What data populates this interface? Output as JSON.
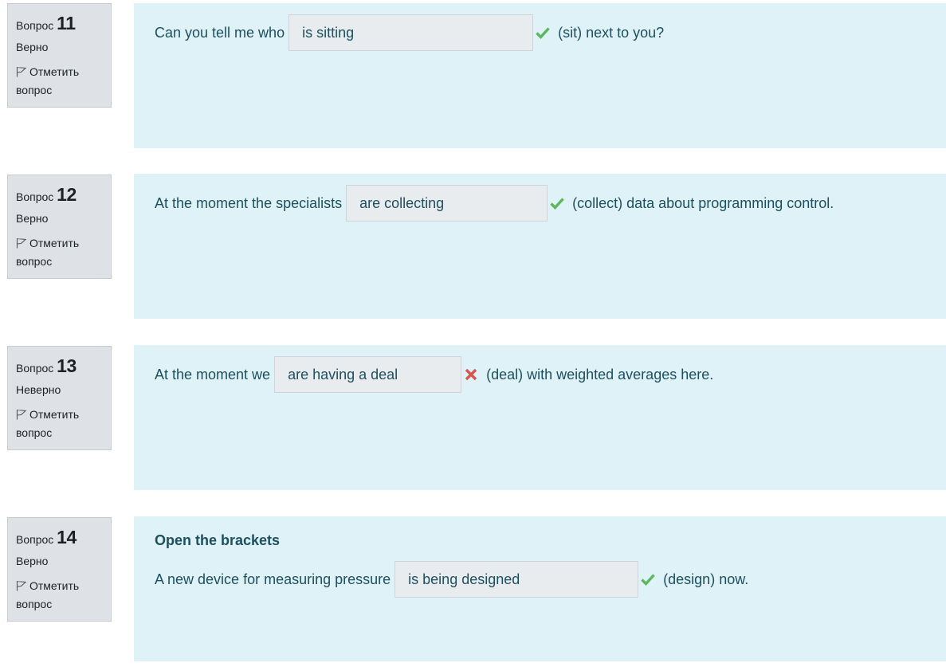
{
  "questions": [
    {
      "label": "Вопрос",
      "number": "11",
      "state": "Верно",
      "flag_label": "Отметить вопрос",
      "heading": "",
      "text_before": "Can you tell me who",
      "answer": "is sitting",
      "mark": "check-icon",
      "text_after": "(sit) next to you?"
    },
    {
      "label": "Вопрос",
      "number": "12",
      "state": "Верно",
      "flag_label": "Отметить вопрос",
      "heading": "",
      "text_before": "At the moment the specialists",
      "answer": "are collecting",
      "mark": "check-icon",
      "text_after": "(collect) data about programming control."
    },
    {
      "label": "Вопрос",
      "number": "13",
      "state": "Неверно",
      "flag_label": "Отметить вопрос",
      "heading": "",
      "text_before": "At the moment we",
      "answer": "are having a deal",
      "mark": "cross-icon",
      "text_after": "(deal) with weighted averages here."
    },
    {
      "label": "Вопрос",
      "number": "14",
      "state": "Верно",
      "flag_label": "Отметить вопрос",
      "heading": "Open the brackets",
      "text_before": "A new device for measuring pressure",
      "answer": "is being designed",
      "mark": "check-icon",
      "text_after": "(design) now."
    }
  ],
  "colors": {
    "correct": "#5cb85c",
    "incorrect": "#d9534f",
    "content_bg": "#def2f8",
    "info_bg": "#dee2e6"
  }
}
